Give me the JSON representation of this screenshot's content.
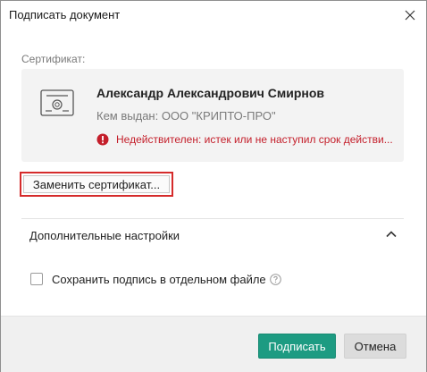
{
  "window": {
    "title": "Подписать документ"
  },
  "certificate": {
    "section_label": "Сертификат:",
    "owner_name": "Александр Александрович Смирнов",
    "issuer": "Кем выдан: ООО \"КРИПТО-ПРО\"",
    "error": "Недействителен: истек или не наступил срок действи..."
  },
  "replace_button_label": "Заменить сертификат...",
  "advanced": {
    "label": "Дополнительные настройки",
    "expanded": true
  },
  "options": {
    "save_separate_label": "Сохранить подпись в отдельном файле",
    "save_separate_checked": false
  },
  "footer": {
    "sign_label": "Подписать",
    "cancel_label": "Отмена"
  },
  "colors": {
    "primary": "#1d9b82",
    "error": "#c41e2a",
    "highlight_border": "#d52b2b"
  }
}
